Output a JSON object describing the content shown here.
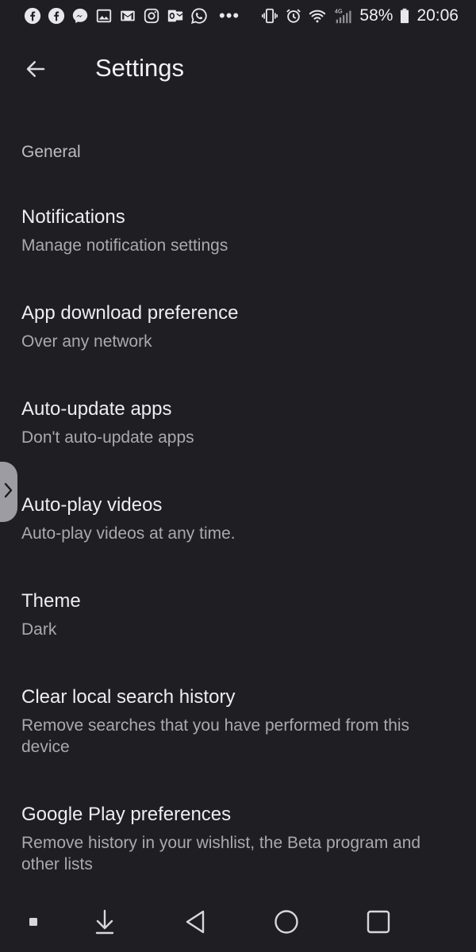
{
  "status_bar": {
    "notification_icons": [
      "facebook-icon",
      "facebook-icon",
      "messenger-icon",
      "gallery-icon",
      "gmail-icon",
      "instagram-icon",
      "outlook-icon",
      "whatsapp-icon"
    ],
    "more_indicator": "•••",
    "network_label": "4G",
    "battery": "58%",
    "time": "20:06"
  },
  "app_bar": {
    "title": "Settings",
    "back_icon": "arrow-back-icon"
  },
  "section": {
    "header": "General"
  },
  "settings": [
    {
      "title": "Notifications",
      "subtitle": "Manage notification settings"
    },
    {
      "title": "App download preference",
      "subtitle": "Over any network"
    },
    {
      "title": "Auto-update apps",
      "subtitle": "Don't auto-update apps"
    },
    {
      "title": "Auto-play videos",
      "subtitle": "Auto-play videos at any time."
    },
    {
      "title": "Theme",
      "subtitle": "Dark"
    },
    {
      "title": "Clear local search history",
      "subtitle": "Remove searches that you have performed from this device"
    },
    {
      "title": "Google Play preferences",
      "subtitle": "Remove history in your wishlist, the Beta program and other lists"
    }
  ],
  "nav_bar": {
    "icons": [
      "small-square-icon",
      "download-arrow-icon",
      "back-triangle-icon",
      "home-circle-icon",
      "recents-square-icon"
    ]
  },
  "colors": {
    "background": "#1f1e23",
    "primary_text": "#eeeef0",
    "secondary_text": "#a9a9af"
  }
}
